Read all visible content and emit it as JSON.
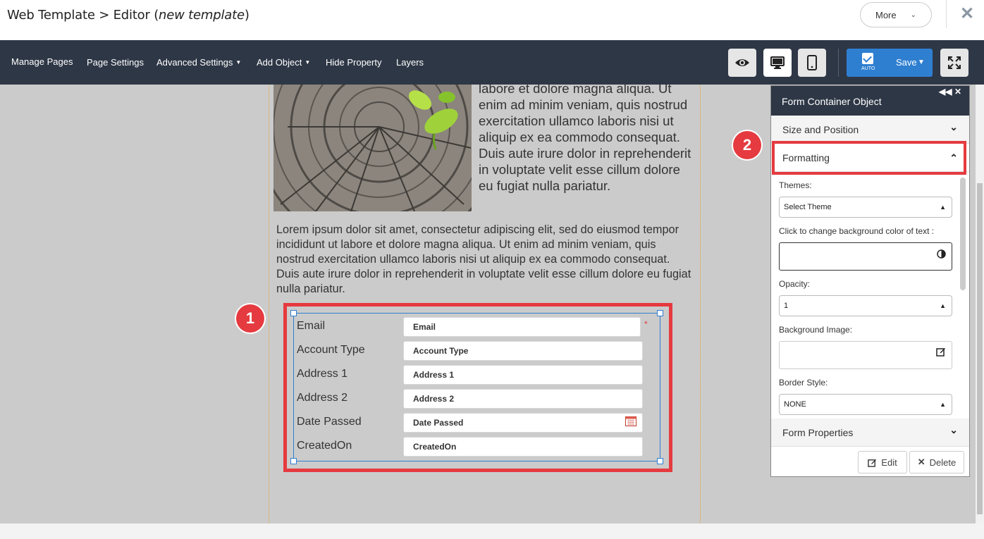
{
  "header": {
    "title_prefix": "Web Template > Editor (",
    "title_italic": "new template",
    "title_suffix": ")",
    "more_label": "More"
  },
  "toolbar": {
    "manage_pages": "Manage Pages",
    "page_settings": "Page Settings",
    "advanced_settings": "Advanced Settings",
    "add_object": "Add Object",
    "hide_property": "Hide Property",
    "layers": "Layers",
    "save_label": "Save",
    "auto_label": "AUTO"
  },
  "content": {
    "paragraph1": "labore et dolore magna aliqua. Ut enim ad minim veniam, quis nostrud exercitation ullamco laboris nisi ut aliquip ex ea commodo consequat. Duis aute irure dolor in reprehenderit in voluptate velit esse cillum dolore eu fugiat nulla pariatur.",
    "paragraph2": "Lorem ipsum dolor sit amet, consectetur adipiscing elit, sed do eiusmod tempor incididunt ut labore et dolore magna aliqua. Ut enim ad minim veniam, quis nostrud exercitation ullamco laboris nisi ut aliquip ex ea commodo consequat. Duis aute irure dolor in reprehenderit in voluptate velit esse cillum dolore eu fugiat nulla pariatur."
  },
  "form": {
    "fields": [
      {
        "label": "Email",
        "placeholder": "Email"
      },
      {
        "label": "Account Type",
        "placeholder": "Account Type"
      },
      {
        "label": "Address 1",
        "placeholder": "Address 1"
      },
      {
        "label": "Address 2",
        "placeholder": "Address 2"
      },
      {
        "label": "Date Passed",
        "placeholder": "Date Passed"
      },
      {
        "label": "CreatedOn",
        "placeholder": "CreatedOn"
      }
    ],
    "required_mark": "*"
  },
  "badges": {
    "one": "1",
    "two": "2"
  },
  "panel": {
    "title": "Form Container Object",
    "size_position": "Size and Position",
    "formatting": "Formatting",
    "themes_label": "Themes:",
    "themes_value": "Select Theme",
    "bgcolor_label": "Click to change background color of text :",
    "opacity_label": "Opacity:",
    "opacity_value": "1",
    "bgimage_label": "Background Image:",
    "border_label": "Border Style:",
    "border_value": "NONE",
    "form_properties": "Form Properties",
    "edit_label": "Edit",
    "delete_label": "Delete"
  },
  "colors": {
    "toolbar_bg": "#2e3746",
    "accent_blue": "#2f7fd1",
    "highlight_red": "#e53a3f",
    "canvas_bg": "#cbcbcb"
  }
}
